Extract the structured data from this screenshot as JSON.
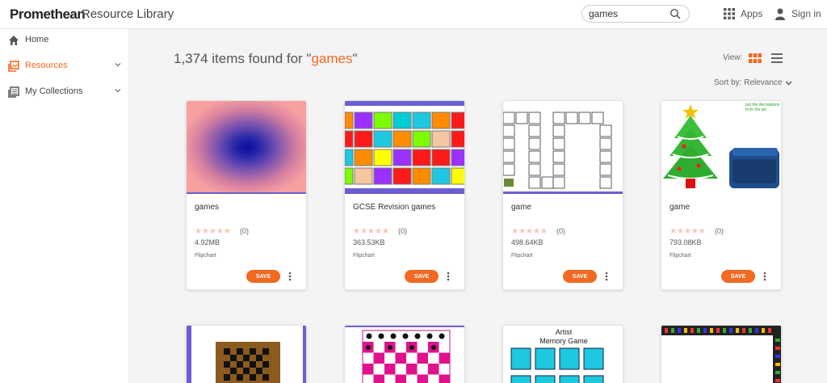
{
  "header": {
    "brand": "Promethean",
    "subtitle": "Resource Library",
    "search": {
      "value": "games"
    },
    "apps_label": "Apps",
    "signin_label": "Sign in"
  },
  "sidebar": {
    "items": [
      {
        "label": "Home",
        "icon": "home-icon"
      },
      {
        "label": "Resources",
        "icon": "resources-icon",
        "active": true
      },
      {
        "label": "My Collections",
        "icon": "collections-icon"
      }
    ]
  },
  "main": {
    "results_count": "1,374 items found for \"",
    "results_query": "games",
    "results_close": "\"",
    "view_label": "View:",
    "sort_label": "Sort by: Relevance"
  },
  "cards": [
    {
      "title": "games",
      "stars": "★★★★★",
      "rating_count": "(0)",
      "size": "4.92MB",
      "type": "Flipchart",
      "save_label": "SAVE"
    },
    {
      "title": "GCSE Revision games",
      "stars": "★★★★★",
      "rating_count": "(0)",
      "size": "363.53KB",
      "type": "Flipchart",
      "save_label": "SAVE"
    },
    {
      "title": "game",
      "stars": "★★★★★",
      "rating_count": "(0)",
      "size": "498.64KB",
      "type": "Flipchart",
      "save_label": "SAVE"
    },
    {
      "title": "game",
      "stars": "★★★★★",
      "rating_count": "(0)",
      "size": "793.08KB",
      "type": "Flipchart",
      "save_label": "SAVE",
      "note": "put the decorations from the pic"
    }
  ],
  "row2": {
    "memory_title_1": "Artist",
    "memory_title_2": "Memory Game"
  },
  "colors": {
    "accent": "#f26922",
    "card_accent": "#6b5fd3"
  }
}
